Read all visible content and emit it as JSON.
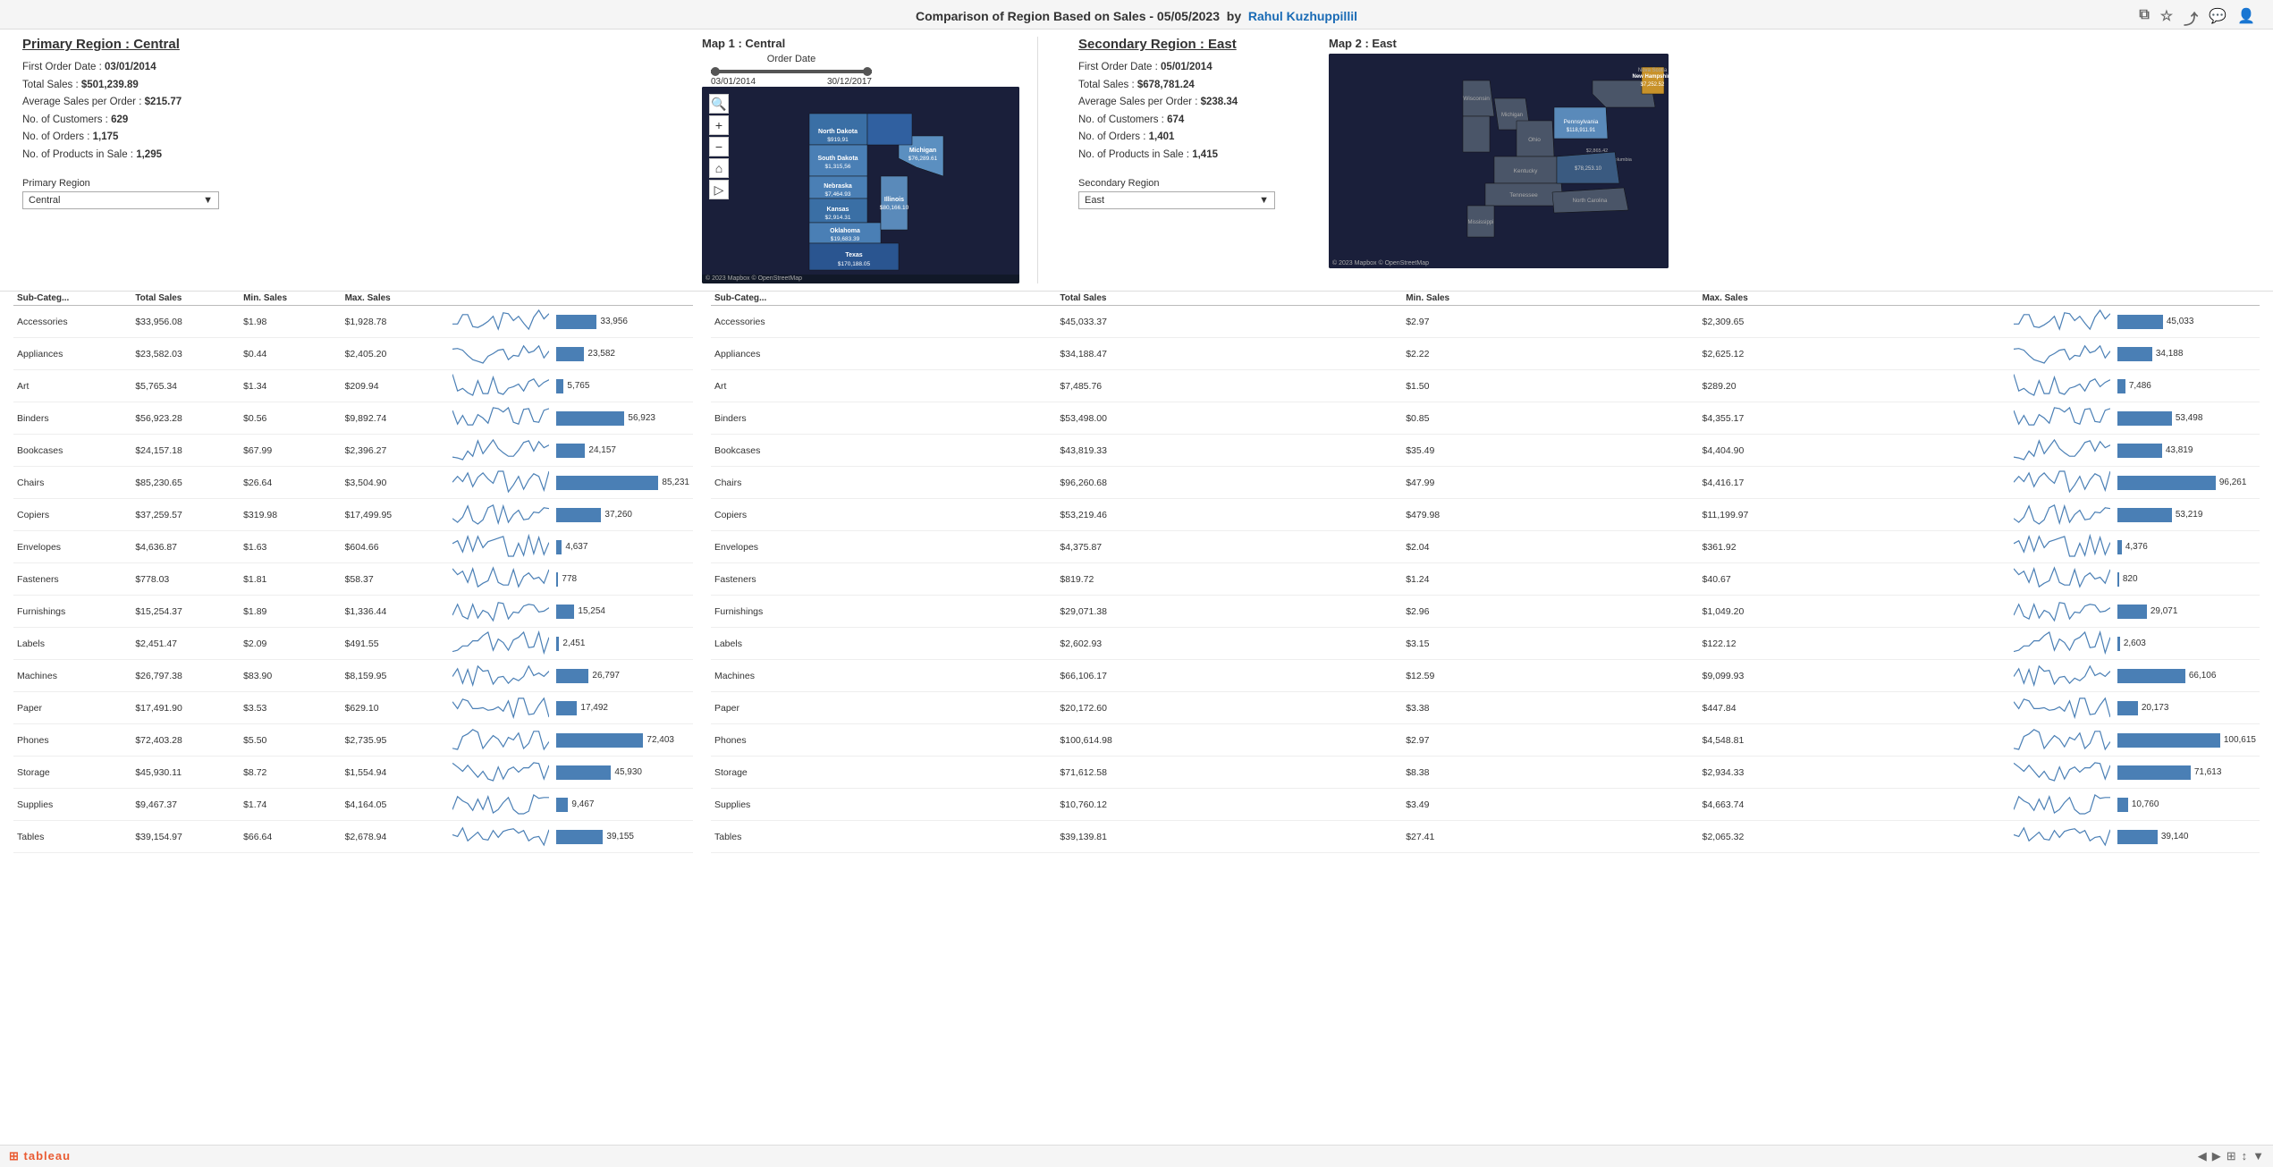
{
  "header": {
    "title": "Comparison of Region Based on Sales - 05/05/2023",
    "author": "Rahul Kuzhuppillil"
  },
  "orderDate": {
    "label": "Order Date",
    "start": "03/01/2014",
    "end": "30/12/2017"
  },
  "primaryRegion": {
    "title": "Primary Region : Central",
    "firstOrderDate": "03/01/2014",
    "totalSales": "$501,239.89",
    "avgSalesPerOrder": "$215.77",
    "noCustomers": "629",
    "noOrders": "1,175",
    "noProductsInSale": "1,295",
    "dropdownLabel": "Primary Region",
    "dropdownValue": "Central",
    "mapTitle": "Map 1 : Central"
  },
  "secondaryRegion": {
    "title": "Secondary Region : East",
    "firstOrderDate": "05/01/2014",
    "totalSales": "$678,781.24",
    "avgSalesPerOrder": "$238.34",
    "noCustomers": "674",
    "noOrders": "1,401",
    "noProductsInSale": "1,415",
    "dropdownLabel": "Secondary Region",
    "dropdownValue": "East",
    "mapTitle": "Map 2 : East"
  },
  "tableHeaders": {
    "subCategory": "Sub-Categ...",
    "totalSales": "Total Sales",
    "minSales": "Min. Sales",
    "maxSales": "Max. Sales",
    "trend": "",
    "bar": ""
  },
  "leftTableRows": [
    {
      "subCategory": "Accessories",
      "totalSales": "$33,956.08",
      "minSales": "$1.98",
      "maxSales": "$1,928.78",
      "barValue": 33956,
      "barMax": 90000
    },
    {
      "subCategory": "Appliances",
      "totalSales": "$23,582.03",
      "minSales": "$0.44",
      "maxSales": "$2,405.20",
      "barValue": 23582,
      "barMax": 90000
    },
    {
      "subCategory": "Art",
      "totalSales": "$5,765.34",
      "minSales": "$1.34",
      "maxSales": "$209.94",
      "barValue": 5765,
      "barMax": 90000
    },
    {
      "subCategory": "Binders",
      "totalSales": "$56,923.28",
      "minSales": "$0.56",
      "maxSales": "$9,892.74",
      "barValue": 56923,
      "barMax": 90000
    },
    {
      "subCategory": "Bookcases",
      "totalSales": "$24,157.18",
      "minSales": "$67.99",
      "maxSales": "$2,396.27",
      "barValue": 24157,
      "barMax": 90000
    },
    {
      "subCategory": "Chairs",
      "totalSales": "$85,230.65",
      "minSales": "$26.64",
      "maxSales": "$3,504.90",
      "barValue": 85231,
      "barMax": 90000
    },
    {
      "subCategory": "Copiers",
      "totalSales": "$37,259.57",
      "minSales": "$319.98",
      "maxSales": "$17,499.95",
      "barValue": 37260,
      "barMax": 90000
    },
    {
      "subCategory": "Envelopes",
      "totalSales": "$4,636.87",
      "minSales": "$1.63",
      "maxSales": "$604.66",
      "barValue": 4637,
      "barMax": 90000
    },
    {
      "subCategory": "Fasteners",
      "totalSales": "$778.03",
      "minSales": "$1.81",
      "maxSales": "$58.37",
      "barValue": 778,
      "barMax": 90000
    },
    {
      "subCategory": "Furnishings",
      "totalSales": "$15,254.37",
      "minSales": "$1.89",
      "maxSales": "$1,336.44",
      "barValue": 15254,
      "barMax": 90000
    },
    {
      "subCategory": "Labels",
      "totalSales": "$2,451.47",
      "minSales": "$2.09",
      "maxSales": "$491.55",
      "barValue": 2451,
      "barMax": 90000
    },
    {
      "subCategory": "Machines",
      "totalSales": "$26,797.38",
      "minSales": "$83.90",
      "maxSales": "$8,159.95",
      "barValue": 26797,
      "barMax": 90000
    },
    {
      "subCategory": "Paper",
      "totalSales": "$17,491.90",
      "minSales": "$3.53",
      "maxSales": "$629.10",
      "barValue": 17492,
      "barMax": 90000
    },
    {
      "subCategory": "Phones",
      "totalSales": "$72,403.28",
      "minSales": "$5.50",
      "maxSales": "$2,735.95",
      "barValue": 72403,
      "barMax": 90000
    },
    {
      "subCategory": "Storage",
      "totalSales": "$45,930.11",
      "minSales": "$8.72",
      "maxSales": "$1,554.94",
      "barValue": 45930,
      "barMax": 90000
    },
    {
      "subCategory": "Supplies",
      "totalSales": "$9,467.37",
      "minSales": "$1.74",
      "maxSales": "$4,164.05",
      "barValue": 9467,
      "barMax": 90000
    },
    {
      "subCategory": "Tables",
      "totalSales": "$39,154.97",
      "minSales": "$66.64",
      "maxSales": "$2,678.94",
      "barValue": 39155,
      "barMax": 90000
    }
  ],
  "rightTableRows": [
    {
      "subCategory": "Accessories",
      "totalSales": "$45,033.37",
      "minSales": "$2.97",
      "maxSales": "$2,309.65",
      "barValue": 45033,
      "barMax": 105000
    },
    {
      "subCategory": "Appliances",
      "totalSales": "$34,188.47",
      "minSales": "$2.22",
      "maxSales": "$2,625.12",
      "barValue": 34188,
      "barMax": 105000
    },
    {
      "subCategory": "Art",
      "totalSales": "$7,485.76",
      "minSales": "$1.50",
      "maxSales": "$289.20",
      "barValue": 7486,
      "barMax": 105000
    },
    {
      "subCategory": "Binders",
      "totalSales": "$53,498.00",
      "minSales": "$0.85",
      "maxSales": "$4,355.17",
      "barValue": 53498,
      "barMax": 105000
    },
    {
      "subCategory": "Bookcases",
      "totalSales": "$43,819.33",
      "minSales": "$35.49",
      "maxSales": "$4,404.90",
      "barValue": 43819,
      "barMax": 105000
    },
    {
      "subCategory": "Chairs",
      "totalSales": "$96,260.68",
      "minSales": "$47.99",
      "maxSales": "$4,416.17",
      "barValue": 96261,
      "barMax": 105000
    },
    {
      "subCategory": "Copiers",
      "totalSales": "$53,219.46",
      "minSales": "$479.98",
      "maxSales": "$11,199.97",
      "barValue": 53219,
      "barMax": 105000
    },
    {
      "subCategory": "Envelopes",
      "totalSales": "$4,375.87",
      "minSales": "$2.04",
      "maxSales": "$361.92",
      "barValue": 4376,
      "barMax": 105000
    },
    {
      "subCategory": "Fasteners",
      "totalSales": "$819.72",
      "minSales": "$1.24",
      "maxSales": "$40.67",
      "barValue": 820,
      "barMax": 105000
    },
    {
      "subCategory": "Furnishings",
      "totalSales": "$29,071.38",
      "minSales": "$2.96",
      "maxSales": "$1,049.20",
      "barValue": 29071,
      "barMax": 105000
    },
    {
      "subCategory": "Labels",
      "totalSales": "$2,602.93",
      "minSales": "$3.15",
      "maxSales": "$122.12",
      "barValue": 2603,
      "barMax": 105000
    },
    {
      "subCategory": "Machines",
      "totalSales": "$66,106.17",
      "minSales": "$12.59",
      "maxSales": "$9,099.93",
      "barValue": 66106,
      "barMax": 105000
    },
    {
      "subCategory": "Paper",
      "totalSales": "$20,172.60",
      "minSales": "$3.38",
      "maxSales": "$447.84",
      "barValue": 20173,
      "barMax": 105000
    },
    {
      "subCategory": "Phones",
      "totalSales": "$100,614.98",
      "minSales": "$2.97",
      "maxSales": "$4,548.81",
      "barValue": 100615,
      "barMax": 105000
    },
    {
      "subCategory": "Storage",
      "totalSales": "$71,612.58",
      "minSales": "$8.38",
      "maxSales": "$2,934.33",
      "barValue": 71613,
      "barMax": 105000
    },
    {
      "subCategory": "Supplies",
      "totalSales": "$10,760.12",
      "minSales": "$3.49",
      "maxSales": "$4,663.74",
      "barValue": 10760,
      "barMax": 105000
    },
    {
      "subCategory": "Tables",
      "totalSales": "$39,139.81",
      "minSales": "$27.41",
      "maxSales": "$2,065.32",
      "barValue": 39140,
      "barMax": 105000
    }
  ],
  "footer": {
    "logo": "tableau",
    "navIcons": [
      "◀",
      "▶",
      "⊞",
      "↕",
      "▼"
    ]
  }
}
